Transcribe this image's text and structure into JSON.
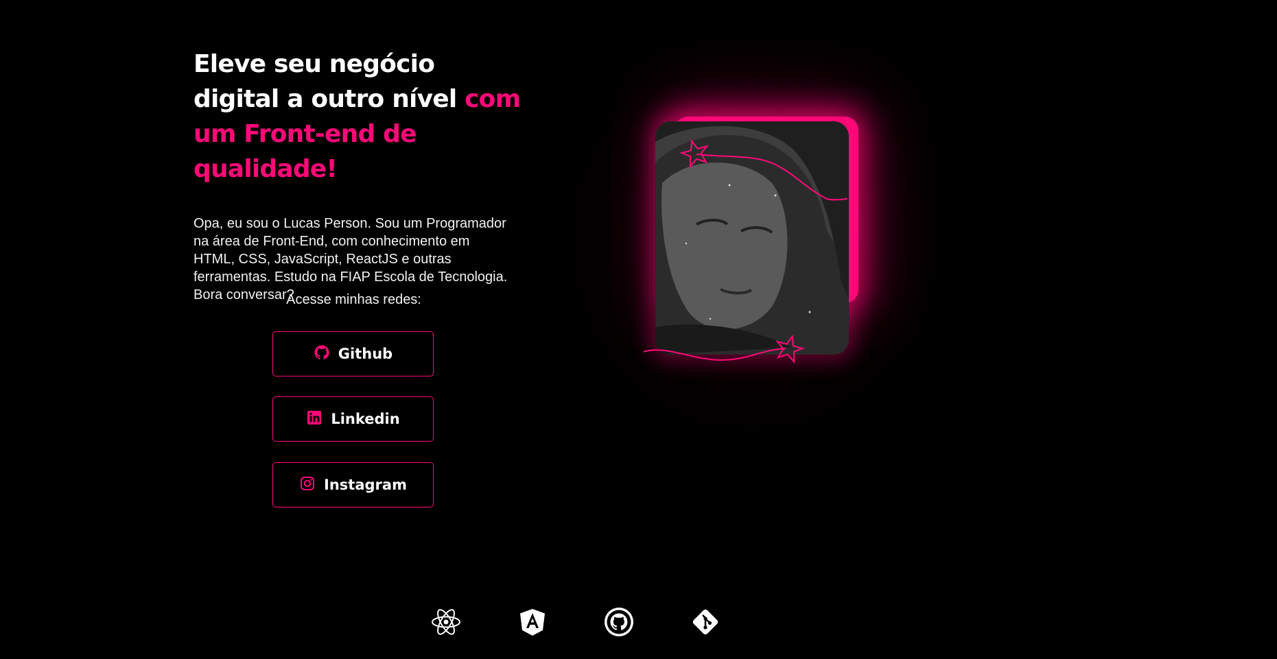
{
  "hero": {
    "headline_white": "Eleve seu negócio digital a outro nível ",
    "headline_accent": "com um Front-end de qualidade!",
    "bio": "Opa, eu sou o Lucas Person. Sou um Programador na área de Front-End, com conhecimento em HTML, CSS, JavaScript, ReactJS e outras ferramentas. Estudo na FIAP Escola de Tecnologia. Bora conversar?"
  },
  "social": {
    "title": "Acesse minhas redes:",
    "buttons": [
      {
        "label": "Github",
        "icon": "github-icon"
      },
      {
        "label": "Linkedin",
        "icon": "linkedin-icon"
      },
      {
        "label": "Instagram",
        "icon": "instagram-icon"
      }
    ]
  },
  "profile": {
    "image": "portrait-photo"
  },
  "tech_icons": [
    "react-icon",
    "angular-icon",
    "github-icon",
    "git-icon"
  ],
  "colors": {
    "accent": "#ff0a78",
    "background": "#000000",
    "text": "#ffffff"
  }
}
